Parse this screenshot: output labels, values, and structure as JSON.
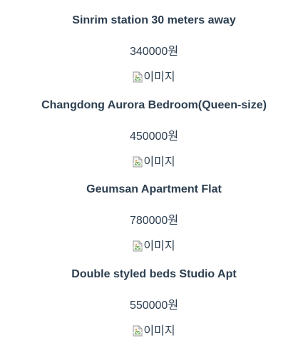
{
  "listings": [
    {
      "title": "Sinrim station 30 meters away",
      "price": "340000원",
      "image_alt": "이미지",
      "image_icon": "broken-image-icon"
    },
    {
      "title": "Changdong Aurora Bedroom(Queen-size)",
      "price": "450000원",
      "image_alt": "이미지",
      "image_icon": "broken-image-icon"
    },
    {
      "title": "Geumsan Apartment Flat",
      "price": "780000원",
      "image_alt": "이미지",
      "image_icon": "broken-image-icon"
    },
    {
      "title": "Double styled beds Studio Apt",
      "price": "550000원",
      "image_alt": "이미지",
      "image_icon": "broken-image-icon"
    }
  ],
  "colors": {
    "text": "#2c3e50",
    "background": "#ffffff"
  }
}
